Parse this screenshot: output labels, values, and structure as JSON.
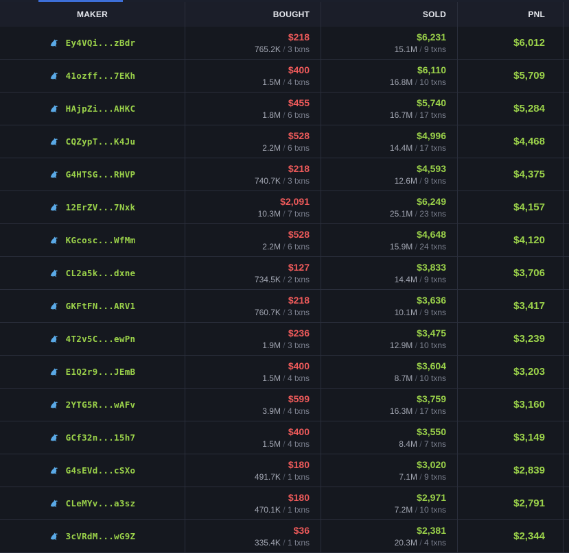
{
  "header": {
    "maker": "MAKER",
    "bought": "BOUGHT",
    "sold": "SOLD",
    "pnl": "PNL"
  },
  "unit_txns": "txns",
  "rows": [
    {
      "maker": "Ey4VQi...zBdr",
      "bought": "$218",
      "bought_vol": "765.2K",
      "bought_txns": "3",
      "sold": "$6,231",
      "sold_vol": "15.1M",
      "sold_txns": "9",
      "pnl": "$6,012"
    },
    {
      "maker": "41ozff...7EKh",
      "bought": "$400",
      "bought_vol": "1.5M",
      "bought_txns": "4",
      "sold": "$6,110",
      "sold_vol": "16.8M",
      "sold_txns": "10",
      "pnl": "$5,709"
    },
    {
      "maker": "HAjpZi...AHKC",
      "bought": "$455",
      "bought_vol": "1.8M",
      "bought_txns": "6",
      "sold": "$5,740",
      "sold_vol": "16.7M",
      "sold_txns": "17",
      "pnl": "$5,284"
    },
    {
      "maker": "CQZypT...K4Ju",
      "bought": "$528",
      "bought_vol": "2.2M",
      "bought_txns": "6",
      "sold": "$4,996",
      "sold_vol": "14.4M",
      "sold_txns": "17",
      "pnl": "$4,468"
    },
    {
      "maker": "G4HTSG...RHVP",
      "bought": "$218",
      "bought_vol": "740.7K",
      "bought_txns": "3",
      "sold": "$4,593",
      "sold_vol": "12.6M",
      "sold_txns": "9",
      "pnl": "$4,375"
    },
    {
      "maker": "12ErZV...7Nxk",
      "bought": "$2,091",
      "bought_vol": "10.3M",
      "bought_txns": "7",
      "sold": "$6,249",
      "sold_vol": "25.1M",
      "sold_txns": "23",
      "pnl": "$4,157"
    },
    {
      "maker": "KGcosc...WfMm",
      "bought": "$528",
      "bought_vol": "2.2M",
      "bought_txns": "6",
      "sold": "$4,648",
      "sold_vol": "15.9M",
      "sold_txns": "24",
      "pnl": "$4,120"
    },
    {
      "maker": "CL2a5k...dxne",
      "bought": "$127",
      "bought_vol": "734.5K",
      "bought_txns": "2",
      "sold": "$3,833",
      "sold_vol": "14.4M",
      "sold_txns": "9",
      "pnl": "$3,706"
    },
    {
      "maker": "GKFtFN...ARV1",
      "bought": "$218",
      "bought_vol": "760.7K",
      "bought_txns": "3",
      "sold": "$3,636",
      "sold_vol": "10.1M",
      "sold_txns": "9",
      "pnl": "$3,417"
    },
    {
      "maker": "4T2v5C...ewPn",
      "bought": "$236",
      "bought_vol": "1.9M",
      "bought_txns": "3",
      "sold": "$3,475",
      "sold_vol": "12.9M",
      "sold_txns": "10",
      "pnl": "$3,239"
    },
    {
      "maker": "E1Q2r9...JEmB",
      "bought": "$400",
      "bought_vol": "1.5M",
      "bought_txns": "4",
      "sold": "$3,604",
      "sold_vol": "8.7M",
      "sold_txns": "10",
      "pnl": "$3,203"
    },
    {
      "maker": "2YTG5R...wAFv",
      "bought": "$599",
      "bought_vol": "3.9M",
      "bought_txns": "4",
      "sold": "$3,759",
      "sold_vol": "16.3M",
      "sold_txns": "17",
      "pnl": "$3,160"
    },
    {
      "maker": "GCf32n...15h7",
      "bought": "$400",
      "bought_vol": "1.5M",
      "bought_txns": "4",
      "sold": "$3,550",
      "sold_vol": "8.4M",
      "sold_txns": "7",
      "pnl": "$3,149"
    },
    {
      "maker": "G4sEVd...cSXo",
      "bought": "$180",
      "bought_vol": "491.7K",
      "bought_txns": "1",
      "sold": "$3,020",
      "sold_vol": "7.1M",
      "sold_txns": "9",
      "pnl": "$2,839"
    },
    {
      "maker": "CLeMYv...a3sz",
      "bought": "$180",
      "bought_vol": "470.1K",
      "bought_txns": "1",
      "sold": "$2,971",
      "sold_vol": "7.2M",
      "sold_txns": "10",
      "pnl": "$2,791"
    },
    {
      "maker": "3cVRdM...wG9Z",
      "bought": "$36",
      "bought_vol": "335.4K",
      "bought_txns": "1",
      "sold": "$2,381",
      "sold_vol": "20.3M",
      "sold_txns": "4",
      "pnl": "$2,344"
    }
  ],
  "colors": {
    "buy": "#ee5a5a",
    "sell": "#9bd24a",
    "address": "#9bd24a",
    "icon": "#5aa9e6"
  },
  "maker_icon": "dolphin-icon"
}
